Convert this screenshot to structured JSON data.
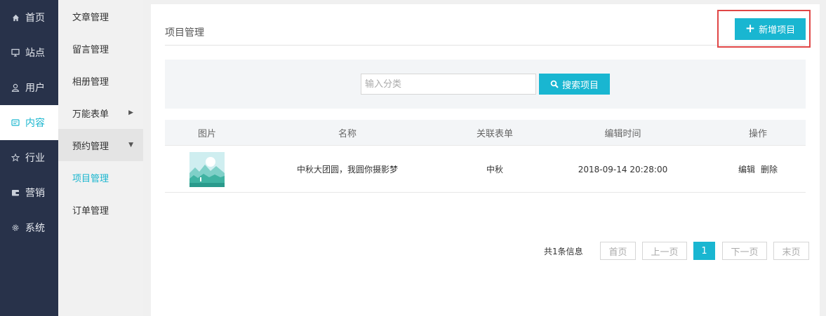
{
  "colors": {
    "accent": "#19b6d1",
    "nav_bg": "#28324a",
    "highlight": "#e04646"
  },
  "nav": {
    "items": [
      {
        "label": "首页",
        "icon": "home-icon"
      },
      {
        "label": "站点",
        "icon": "monitor-icon"
      },
      {
        "label": "用户",
        "icon": "user-icon"
      },
      {
        "label": "内容",
        "icon": "content-icon",
        "active": true
      },
      {
        "label": "行业",
        "icon": "star-icon"
      },
      {
        "label": "营销",
        "icon": "wallet-icon"
      },
      {
        "label": "系统",
        "icon": "gear-icon"
      }
    ]
  },
  "subnav": {
    "items": [
      {
        "label": "文章管理"
      },
      {
        "label": "留言管理"
      },
      {
        "label": "相册管理"
      },
      {
        "label": "万能表单",
        "caret": "right"
      },
      {
        "label": "预约管理",
        "caret": "down"
      },
      {
        "label": "项目管理",
        "current": true
      },
      {
        "label": "订单管理"
      }
    ]
  },
  "main": {
    "title": "项目管理",
    "add_button": "新增项目",
    "search": {
      "placeholder": "输入分类",
      "value": "",
      "button": "搜索项目"
    },
    "table": {
      "headers": [
        "图片",
        "名称",
        "关联表单",
        "编辑时间",
        "操作"
      ],
      "rows": [
        {
          "name": "中秋大团圆，我圆你摄影梦",
          "form": "中秋",
          "time": "2018-09-14 20:28:00",
          "actions": [
            "编辑",
            "删除"
          ]
        }
      ]
    },
    "pagination": {
      "info": "共1条信息",
      "first": "首页",
      "prev": "上一页",
      "current": "1",
      "next": "下一页",
      "last": "末页"
    }
  }
}
